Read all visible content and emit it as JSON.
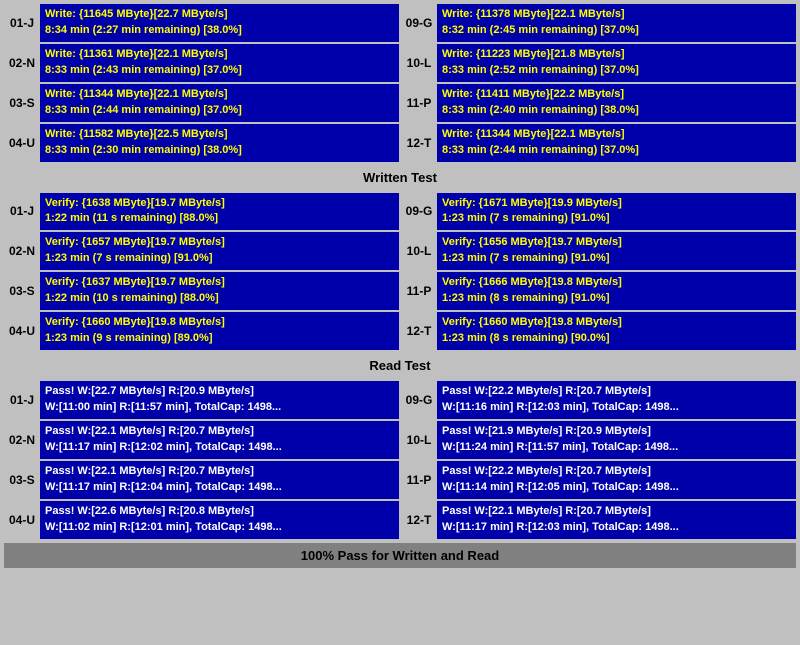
{
  "sections": {
    "write": {
      "header": "Written Test",
      "left": [
        {
          "id": "01-J",
          "line1": "Write: {11645 MByte}[22.7 MByte/s]",
          "line2": "8:34 min (2:27 min remaining)  [38.0%]"
        },
        {
          "id": "02-N",
          "line1": "Write: {11361 MByte}[22.1 MByte/s]",
          "line2": "8:33 min (2:43 min remaining)  [37.0%]"
        },
        {
          "id": "03-S",
          "line1": "Write: {11344 MByte}[22.1 MByte/s]",
          "line2": "8:33 min (2:44 min remaining)  [37.0%]"
        },
        {
          "id": "04-U",
          "line1": "Write: {11582 MByte}[22.5 MByte/s]",
          "line2": "8:33 min (2:30 min remaining)  [38.0%]"
        }
      ],
      "right": [
        {
          "id": "09-G",
          "line1": "Write: {11378 MByte}[22.1 MByte/s]",
          "line2": "8:32 min (2:45 min remaining)  [37.0%]"
        },
        {
          "id": "10-L",
          "line1": "Write: {11223 MByte}[21.8 MByte/s]",
          "line2": "8:33 min (2:52 min remaining)  [37.0%]"
        },
        {
          "id": "11-P",
          "line1": "Write: {11411 MByte}[22.2 MByte/s]",
          "line2": "8:33 min (2:40 min remaining)  [38.0%]"
        },
        {
          "id": "12-T",
          "line1": "Write: {11344 MByte}[22.1 MByte/s]",
          "line2": "8:33 min (2:44 min remaining)  [37.0%]"
        }
      ]
    },
    "verify": {
      "header": "Written Test",
      "left": [
        {
          "id": "01-J",
          "line1": "Verify: {1638 MByte}[19.7 MByte/s]",
          "line2": "1:22 min (11 s remaining)   [88.0%]"
        },
        {
          "id": "02-N",
          "line1": "Verify: {1657 MByte}[19.7 MByte/s]",
          "line2": "1:23 min (7 s remaining)   [91.0%]"
        },
        {
          "id": "03-S",
          "line1": "Verify: {1637 MByte}[19.7 MByte/s]",
          "line2": "1:22 min (10 s remaining)   [88.0%]"
        },
        {
          "id": "04-U",
          "line1": "Verify: {1660 MByte}[19.8 MByte/s]",
          "line2": "1:23 min (9 s remaining)   [89.0%]"
        }
      ],
      "right": [
        {
          "id": "09-G",
          "line1": "Verify: {1671 MByte}[19.9 MByte/s]",
          "line2": "1:23 min (7 s remaining)   [91.0%]"
        },
        {
          "id": "10-L",
          "line1": "Verify: {1656 MByte}[19.7 MByte/s]",
          "line2": "1:23 min (7 s remaining)   [91.0%]"
        },
        {
          "id": "11-P",
          "line1": "Verify: {1666 MByte}[19.8 MByte/s]",
          "line2": "1:23 min (8 s remaining)   [91.0%]"
        },
        {
          "id": "12-T",
          "line1": "Verify: {1660 MByte}[19.8 MByte/s]",
          "line2": "1:23 min (8 s remaining)   [90.0%]"
        }
      ]
    },
    "read": {
      "header": "Read Test",
      "left": [
        {
          "id": "01-J",
          "line1": "Pass! W:[22.7 MByte/s] R:[20.9 MByte/s]",
          "line2": "W:[11:00 min] R:[11:57 min], TotalCap: 1498..."
        },
        {
          "id": "02-N",
          "line1": "Pass! W:[22.1 MByte/s] R:[20.7 MByte/s]",
          "line2": "W:[11:17 min] R:[12:02 min], TotalCap: 1498..."
        },
        {
          "id": "03-S",
          "line1": "Pass! W:[22.1 MByte/s] R:[20.7 MByte/s]",
          "line2": "W:[11:17 min] R:[12:04 min], TotalCap: 1498..."
        },
        {
          "id": "04-U",
          "line1": "Pass! W:[22.6 MByte/s] R:[20.8 MByte/s]",
          "line2": "W:[11:02 min] R:[12:01 min], TotalCap: 1498..."
        }
      ],
      "right": [
        {
          "id": "09-G",
          "line1": "Pass! W:[22.2 MByte/s] R:[20.7 MByte/s]",
          "line2": "W:[11:16 min] R:[12:03 min], TotalCap: 1498..."
        },
        {
          "id": "10-L",
          "line1": "Pass! W:[21.9 MByte/s] R:[20.9 MByte/s]",
          "line2": "W:[11:24 min] R:[11:57 min], TotalCap: 1498..."
        },
        {
          "id": "11-P",
          "line1": "Pass! W:[22.2 MByte/s] R:[20.7 MByte/s]",
          "line2": "W:[11:14 min] R:[12:05 min], TotalCap: 1498..."
        },
        {
          "id": "12-T",
          "line1": "Pass! W:[22.1 MByte/s] R:[20.7 MByte/s]",
          "line2": "W:[11:17 min] R:[12:03 min], TotalCap: 1498..."
        }
      ]
    }
  },
  "footer": "100% Pass for Written and Read",
  "section_header_write": "Written Test",
  "section_header_read": "Read Test"
}
